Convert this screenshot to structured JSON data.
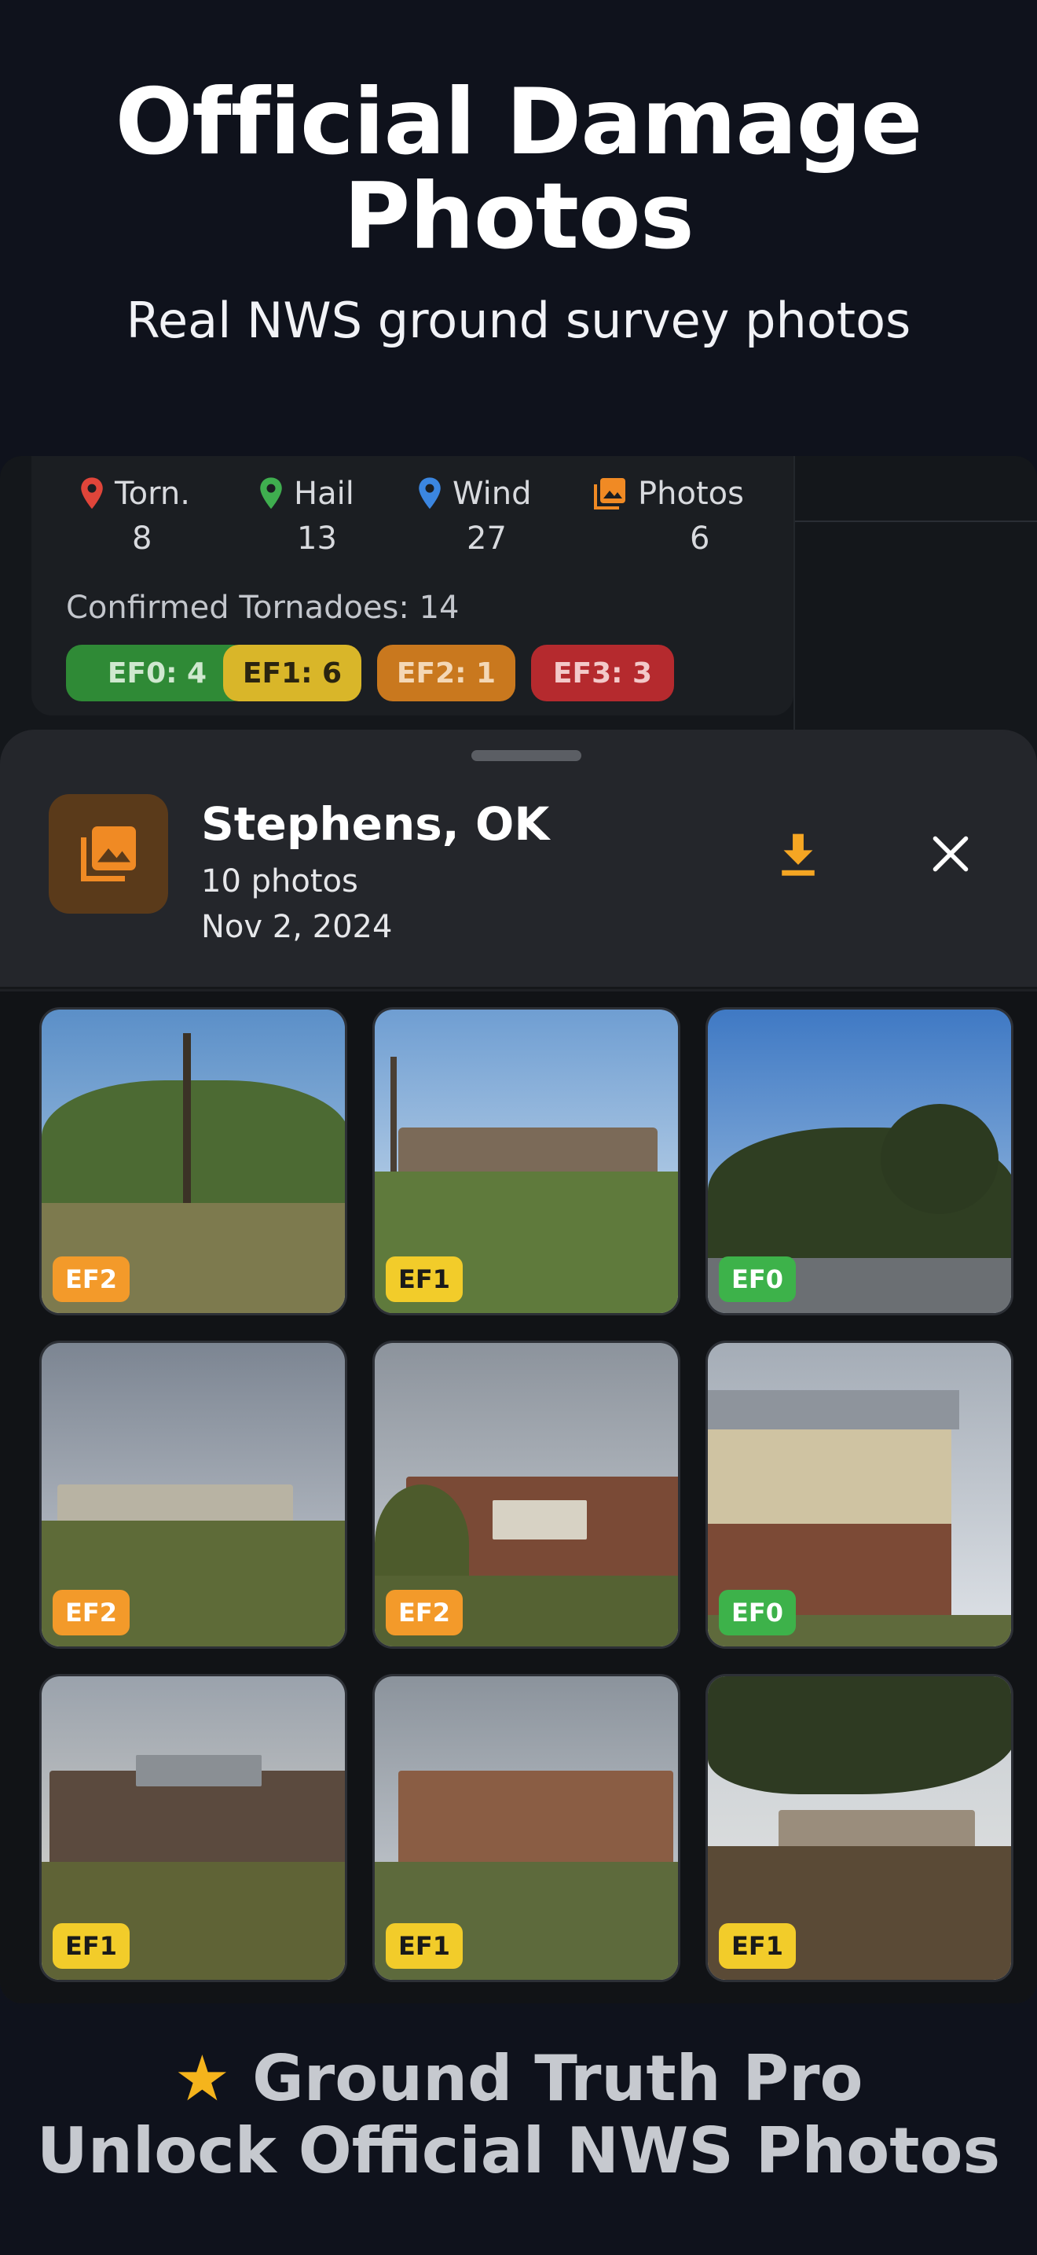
{
  "hero": {
    "title_line1": "Official Damage",
    "title_line2": "Photos",
    "subtitle": "Real NWS ground survey photos"
  },
  "stats": [
    {
      "icon": "tornado-pin-icon",
      "label": "Torn.",
      "value": "8",
      "color": "#e0453a"
    },
    {
      "icon": "hail-pin-icon",
      "label": "Hail",
      "value": "13",
      "color": "#3fae4f"
    },
    {
      "icon": "wind-pin-icon",
      "label": "Wind",
      "value": "27",
      "color": "#3b86e0"
    },
    {
      "icon": "photos-icon",
      "label": "Photos",
      "value": "6",
      "color": "#f08a24"
    }
  ],
  "confirmed_label": "Confirmed Tornadoes: 14",
  "ef_pills": [
    {
      "label": "EF0: 4",
      "bg": "#2f8a36",
      "fg": "#cfe8cf"
    },
    {
      "label": "EF1: 6",
      "bg": "#d9b629",
      "fg": "#2a2410"
    },
    {
      "label": "EF2: 1",
      "bg": "#c9781e",
      "fg": "#f4d8b6"
    },
    {
      "label": "EF3: 3",
      "bg": "#b52a2e",
      "fg": "#f3c9c9"
    }
  ],
  "sheet": {
    "location": "Stephens, OK",
    "count": "10 photos",
    "date": "Nov 2, 2024",
    "album_icon": "photo-album-icon",
    "download_icon": "download-icon",
    "close_icon": "close-icon"
  },
  "photos": [
    {
      "rating": "EF2",
      "scene": "field-with-utility-pole"
    },
    {
      "rating": "EF1",
      "scene": "damaged-houses-distance"
    },
    {
      "rating": "EF0",
      "scene": "trees-blue-sky"
    },
    {
      "rating": "EF2",
      "scene": "houses-with-dirt-road"
    },
    {
      "rating": "EF2",
      "scene": "brick-house-roof-damage"
    },
    {
      "rating": "EF0",
      "scene": "two-story-house-balcony"
    },
    {
      "rating": "EF1",
      "scene": "house-roof-torn"
    },
    {
      "rating": "EF1",
      "scene": "brick-house-with-fence"
    },
    {
      "rating": "EF1",
      "scene": "debris-under-tree"
    }
  ],
  "rating_colors": {
    "EF0": {
      "bg": "#3db24a",
      "fg": "#ffffff"
    },
    "EF1": {
      "bg": "#f2cc2a",
      "fg": "#1a1a1a"
    },
    "EF2": {
      "bg": "#f39a2a",
      "fg": "#ffffff"
    }
  },
  "footer": {
    "star": "★",
    "line1": "Ground Truth Pro",
    "line2": "Unlock Official NWS Photos"
  }
}
